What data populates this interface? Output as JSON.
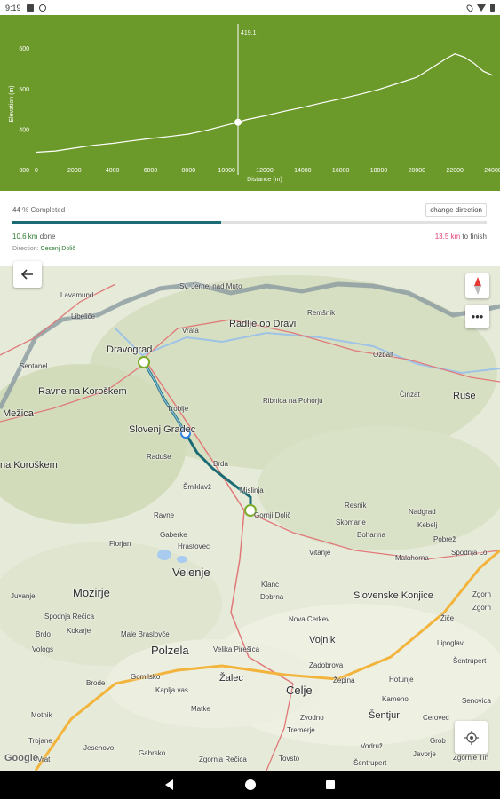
{
  "status_bar": {
    "time": "9:19"
  },
  "elevation": {
    "marker_value": "419.1",
    "y_axis_label": "Elevation (m)",
    "x_axis_label": "Distance (m)",
    "y_ticks": [
      "600",
      "500",
      "400",
      "300"
    ],
    "x_ticks": [
      "0",
      "2000",
      "4000",
      "6000",
      "8000",
      "10000",
      "12000",
      "14000",
      "16000",
      "18000",
      "20000",
      "22000",
      "24000"
    ]
  },
  "chart_data": {
    "type": "area",
    "ylabel": "Elevation (m)",
    "xlabel": "Distance (m)",
    "xlim": [
      0,
      24000
    ],
    "ylim": [
      300,
      640
    ],
    "marker": {
      "x": 10600,
      "y": 419.1
    },
    "x": [
      0,
      1000,
      2000,
      3000,
      4000,
      5000,
      6000,
      7000,
      8000,
      9000,
      10000,
      10600,
      11000,
      12000,
      13000,
      14000,
      15000,
      16000,
      17000,
      18000,
      19000,
      20000,
      20500,
      21000,
      21500,
      22000,
      22500,
      23000,
      23500,
      24000
    ],
    "y": [
      345,
      348,
      355,
      362,
      367,
      373,
      379,
      384,
      390,
      400,
      412,
      419,
      425,
      435,
      446,
      456,
      467,
      477,
      488,
      500,
      515,
      530,
      545,
      560,
      575,
      588,
      580,
      565,
      545,
      535
    ]
  },
  "progress": {
    "percent": "44",
    "percent_suffix": " % Completed",
    "fraction": 0.44,
    "change_direction": "change direction",
    "done_value": "10.6 km",
    "done_suffix": " done",
    "finish_value": "13.5 km",
    "finish_suffix": " to finish",
    "direction_label": "Direction:",
    "direction_value": "Cesenj Dolič"
  },
  "map": {
    "places": [
      {
        "name": "Lavamund"
      },
      {
        "name": "Libeliče"
      },
      {
        "name": "Sv. Jernej nad Muto"
      },
      {
        "name": "Remšnik"
      },
      {
        "name": "Radlje ob Dravi"
      },
      {
        "name": "Vrata"
      },
      {
        "name": "Dravograd"
      },
      {
        "name": "Sentanel"
      },
      {
        "name": "Ožbalt"
      },
      {
        "name": "Ravne na Koroškem"
      },
      {
        "name": "Mežica"
      },
      {
        "name": "Ribnica na Pohorju"
      },
      {
        "name": "Činžat"
      },
      {
        "name": "Ruše"
      },
      {
        "name": "Troblje"
      },
      {
        "name": "Slovenj Gradec"
      },
      {
        "name": "Raduše"
      },
      {
        "name": "Brda"
      },
      {
        "name": "na Koroškem"
      },
      {
        "name": "Šmiklavž"
      },
      {
        "name": "Mislinja"
      },
      {
        "name": "Gornji Dolič"
      },
      {
        "name": "Resnik"
      },
      {
        "name": "Nadgrad"
      },
      {
        "name": "Skomarje"
      },
      {
        "name": "Kebelj"
      },
      {
        "name": "Ravne"
      },
      {
        "name": "Boharina"
      },
      {
        "name": "Gaberke"
      },
      {
        "name": "Florjan"
      },
      {
        "name": "Hrastovec"
      },
      {
        "name": "Pobrež"
      },
      {
        "name": "Vitanje"
      },
      {
        "name": "Spodnja Lo"
      },
      {
        "name": "Velenje"
      },
      {
        "name": "Malahorna"
      },
      {
        "name": "Klanc"
      },
      {
        "name": "Slovenske Konjice"
      },
      {
        "name": "Mozirje"
      },
      {
        "name": "Dobrna"
      },
      {
        "name": "Juvanje"
      },
      {
        "name": "Zgorn"
      },
      {
        "name": "Spodnja Rečica"
      },
      {
        "name": "Nova Cerkev"
      },
      {
        "name": "Žiče"
      },
      {
        "name": "Brdo"
      },
      {
        "name": "Kokarje"
      },
      {
        "name": "Male Braslovče"
      },
      {
        "name": "Vojnik"
      },
      {
        "name": "Zgorn"
      },
      {
        "name": "Vologs"
      },
      {
        "name": "Polzela"
      },
      {
        "name": "Velika Pirešica"
      },
      {
        "name": "Lipoglav"
      },
      {
        "name": "Zadobrova"
      },
      {
        "name": "Gomilsko"
      },
      {
        "name": "Šentrupert"
      },
      {
        "name": "Brode"
      },
      {
        "name": "Žalec"
      },
      {
        "name": "Celje"
      },
      {
        "name": "Žepina"
      },
      {
        "name": "Hotunje"
      },
      {
        "name": "Kaplja vas"
      },
      {
        "name": "Kameno"
      },
      {
        "name": "Senovica"
      },
      {
        "name": "Šentjur"
      },
      {
        "name": "Cerovec"
      },
      {
        "name": "Matke"
      },
      {
        "name": "Zvodno"
      },
      {
        "name": "Motnik"
      },
      {
        "name": "Tremerje"
      },
      {
        "name": "Trojane"
      },
      {
        "name": "Vodruž"
      },
      {
        "name": "Grob"
      },
      {
        "name": "Jesenovo"
      },
      {
        "name": "Gabrsko"
      },
      {
        "name": "Tovsto"
      },
      {
        "name": "Javorje"
      },
      {
        "name": "Zgornja Rečica"
      },
      {
        "name": "Šentrupert"
      },
      {
        "name": "Zgornje Tin"
      },
      {
        "name": "Vrat"
      }
    ],
    "google_label": "Google",
    "more_label": "•••"
  }
}
